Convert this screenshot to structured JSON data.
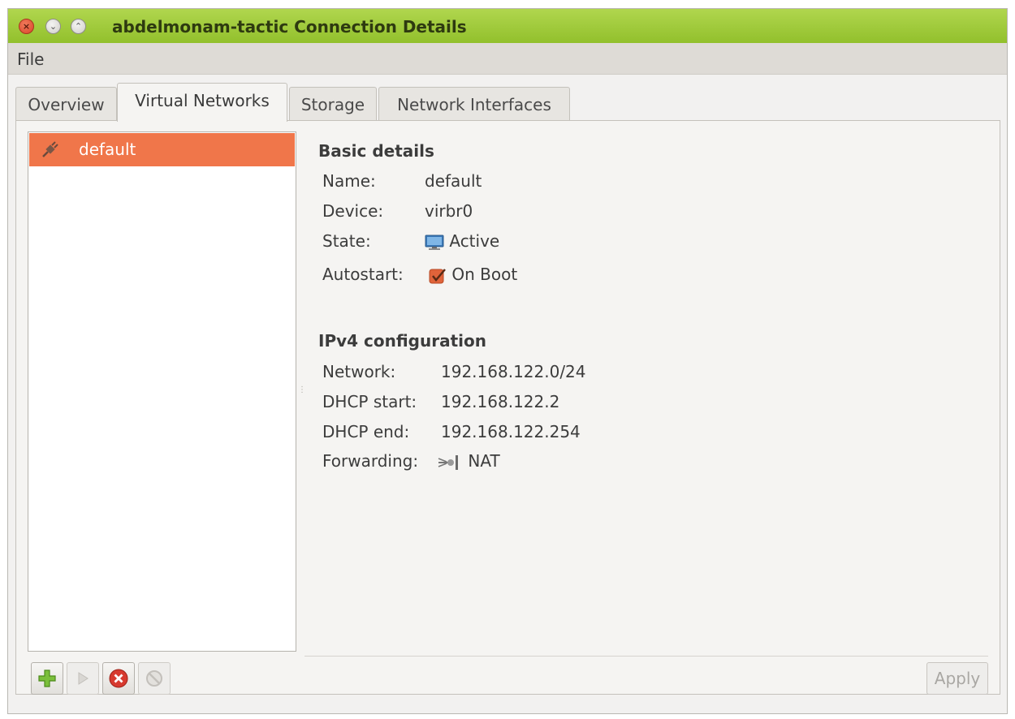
{
  "window": {
    "title": "abdelmonam-tactic Connection Details",
    "controls": {
      "close": "×",
      "minimize": "⌄",
      "maximize": "⌃"
    }
  },
  "menubar": {
    "file": "File"
  },
  "tabs": [
    {
      "label": "Overview",
      "active": false
    },
    {
      "label": "Virtual Networks",
      "active": true
    },
    {
      "label": "Storage",
      "active": false
    },
    {
      "label": "Network Interfaces",
      "active": false
    }
  ],
  "networks": [
    {
      "name": "default",
      "selected": true,
      "icon": "network-plug-icon"
    }
  ],
  "basic": {
    "title": "Basic details",
    "name_label": "Name:",
    "name_value": "default",
    "device_label": "Device:",
    "device_value": "virbr0",
    "state_label": "State:",
    "state_value": "Active",
    "state_icon": "monitor-icon",
    "autostart_label": "Autostart:",
    "autostart_value": "On Boot",
    "autostart_checked": true
  },
  "ipv4": {
    "title": "IPv4 configuration",
    "network_label": "Network:",
    "network_value": "192.168.122.0/24",
    "dhcp_start_label": "DHCP start:",
    "dhcp_start_value": "192.168.122.2",
    "dhcp_end_label": "DHCP end:",
    "dhcp_end_value": "192.168.122.254",
    "forwarding_label": "Forwarding:",
    "forwarding_value": "NAT",
    "forwarding_icon": "nat-routing-icon"
  },
  "toolbar": {
    "add": "add-network-icon",
    "start": "start-network-icon",
    "delete": "delete-network-icon",
    "stop": "stop-network-icon",
    "apply_label": "Apply"
  },
  "colors": {
    "titlebar": "#9cc93a",
    "selection": "#f0764a",
    "accent_check": "#e0633a"
  }
}
